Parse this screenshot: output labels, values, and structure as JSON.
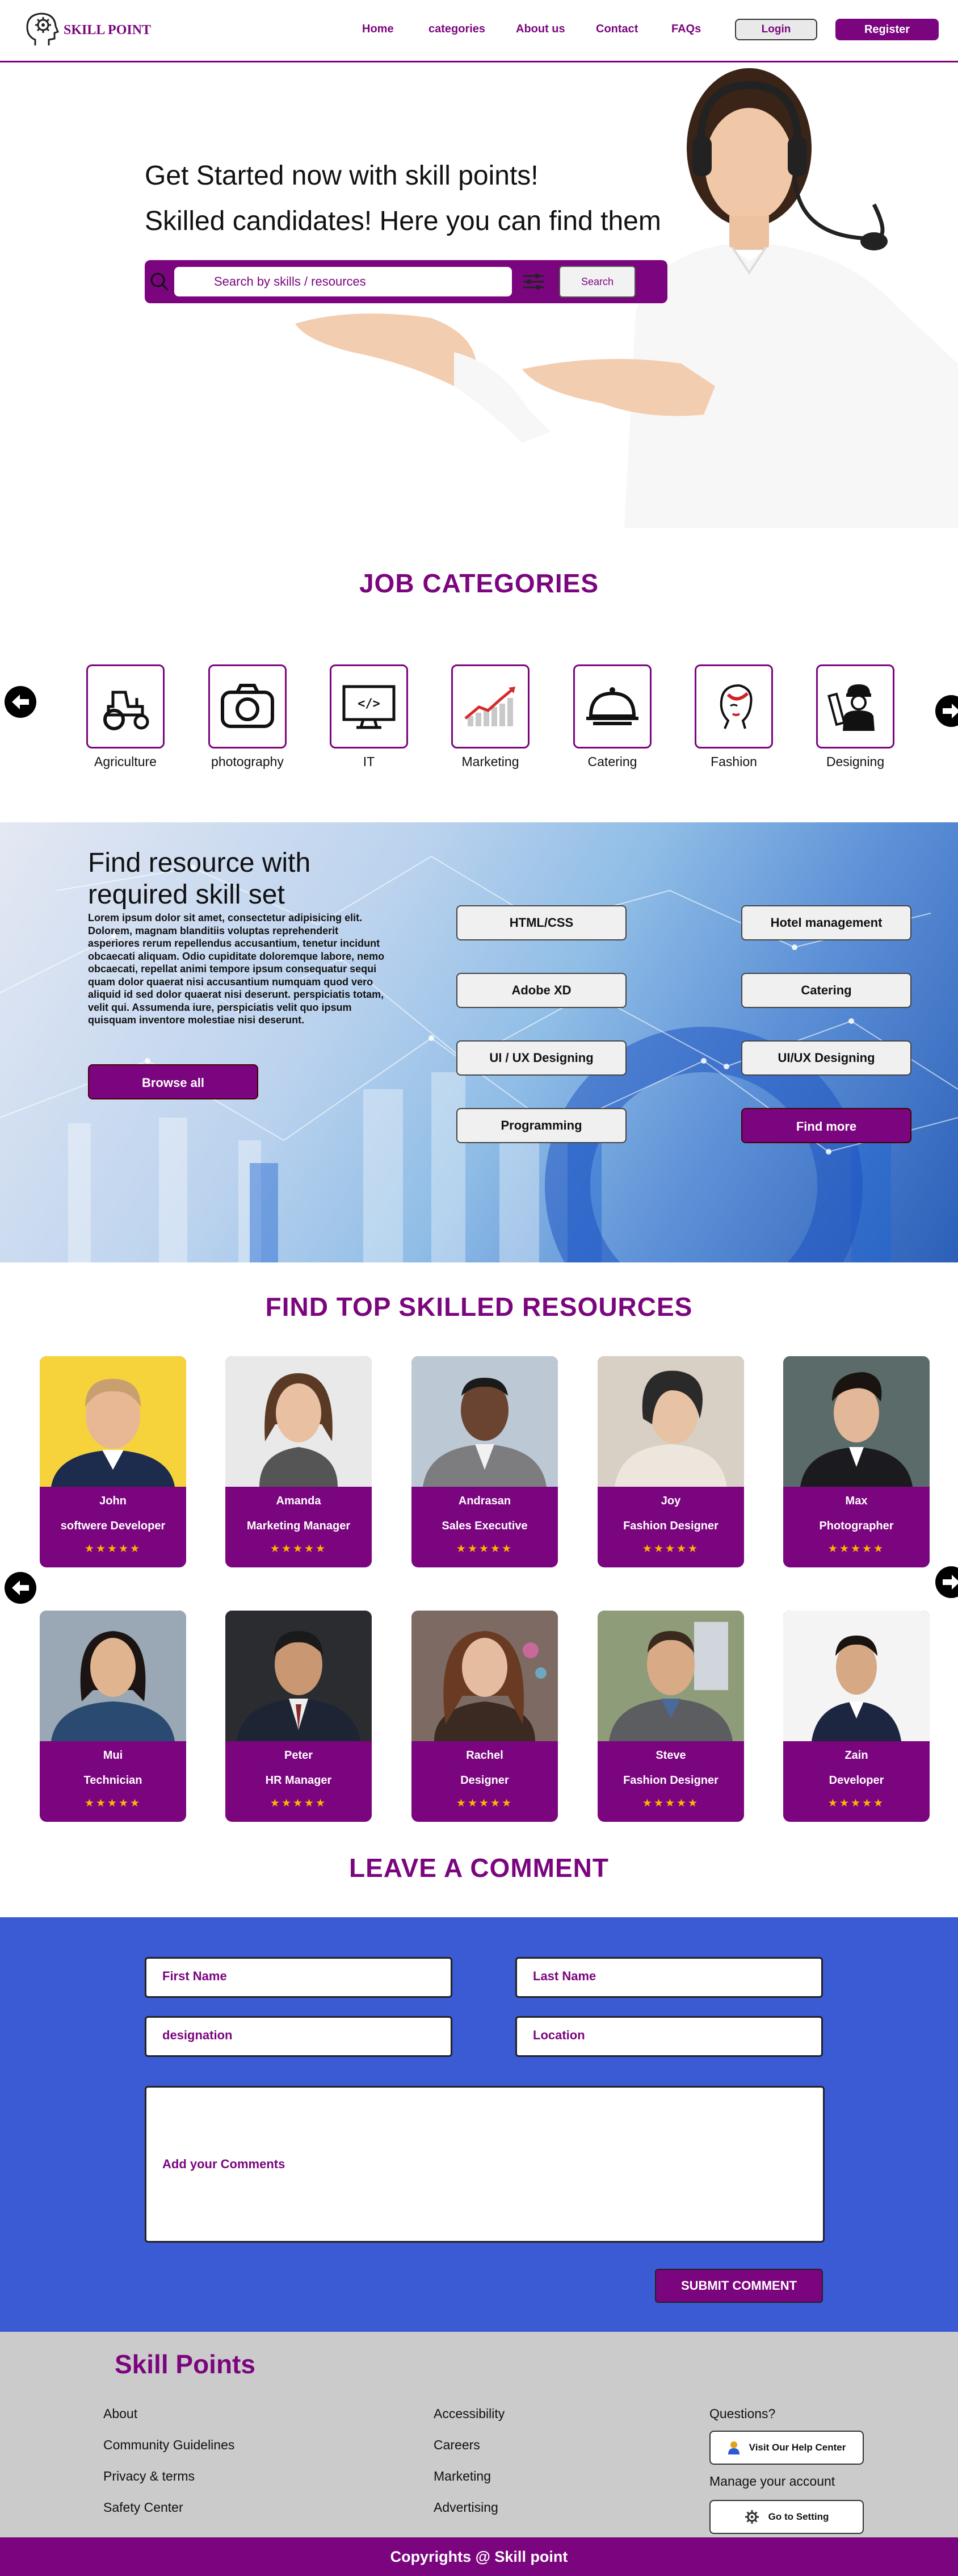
{
  "header": {
    "logo_text": "SKILL POINT",
    "nav": [
      "Home",
      "categories",
      "About us",
      "Contact",
      "FAQs"
    ],
    "login_label": "Login",
    "register_label": "Register"
  },
  "hero": {
    "line1": "Get Started now with skill points!",
    "line2": "Skilled candidates! Here you can find them",
    "search_placeholder": "Search by skills / resources",
    "search_button": "Search"
  },
  "categories": {
    "title": "JOB CATEGORIES",
    "items": [
      {
        "label": "Agriculture",
        "icon": "tractor-icon"
      },
      {
        "label": "photography",
        "icon": "camera-icon"
      },
      {
        "label": "IT",
        "icon": "monitor-code-icon"
      },
      {
        "label": "Marketing",
        "icon": "chart-growth-icon"
      },
      {
        "label": "Catering",
        "icon": "cloche-icon"
      },
      {
        "label": "Fashion",
        "icon": "fashion-face-icon"
      },
      {
        "label": "Designing",
        "icon": "designer-icon"
      }
    ]
  },
  "resources": {
    "heading": "Find resource with required skill set",
    "paragraph": "Lorem ipsum dolor sit amet, consectetur adipisicing elit. Dolorem, magnam blanditiis voluptas reprehenderit asperiores rerum repellendus accusantium, tenetur incidunt obcaecati aliquam. Odio cupiditate doloremque labore, nemo obcaecati, repellat animi tempore ipsum consequatur sequi quam dolor quaerat nisi accusantium numquam quod vero aliquid id sed dolor quaerat nisi deserunt. perspiciatis totam, velit qui. Assumenda iure, perspiciatis velit quo ipsum quisquam inventore molestiae nisi deserunt.",
    "browse_label": "Browse all",
    "skills_left": [
      "HTML/CSS",
      "Adobe XD",
      "UI / UX Designing",
      "Programming"
    ],
    "skills_right": [
      "Hotel management",
      "Catering",
      "UI/UX Designing"
    ],
    "find_more_label": "Find more"
  },
  "people": {
    "title": "FIND TOP SKILLED RESOURCES",
    "row1": [
      {
        "name": "John",
        "role": "softwere Developer"
      },
      {
        "name": "Amanda",
        "role": "Marketing Manager"
      },
      {
        "name": "Andrasan",
        "role": "Sales Executive"
      },
      {
        "name": "Joy",
        "role": "Fashion Designer"
      },
      {
        "name": "Max",
        "role": "Photographer"
      }
    ],
    "row2": [
      {
        "name": "Mui",
        "role": "Technician"
      },
      {
        "name": "Peter",
        "role": "HR Manager"
      },
      {
        "name": "Rachel",
        "role": "Designer"
      },
      {
        "name": "Steve",
        "role": "Fashion Designer"
      },
      {
        "name": "Zain",
        "role": "Developer"
      }
    ],
    "stars": "★★★★★",
    "rating_stars": 5
  },
  "comment": {
    "title": "LEAVE A COMMENT",
    "first_name": "First Name",
    "last_name": "Last Name",
    "designation": "designation",
    "location": "Location",
    "comments": "Add your Comments",
    "submit_label": "SUBMIT COMMENT"
  },
  "footer": {
    "brand": "Skill Points",
    "col1": [
      "About",
      "Community Guidelines",
      "Privacy & terms",
      "Safety Center"
    ],
    "col2": [
      "Accessibility",
      "Careers",
      "Marketing",
      "Advertising"
    ],
    "questions": "Questions?",
    "help_button": "Visit Our Help Center",
    "manage": "Manage your account",
    "setting_button": "Go to Setting",
    "copyright": "Copyrights @ Skill point"
  },
  "colors": {
    "primary": "#7b057e",
    "comment_bg": "#3a5bd4",
    "footer_bg": "#cbcbcb",
    "star": "#ffb400"
  }
}
